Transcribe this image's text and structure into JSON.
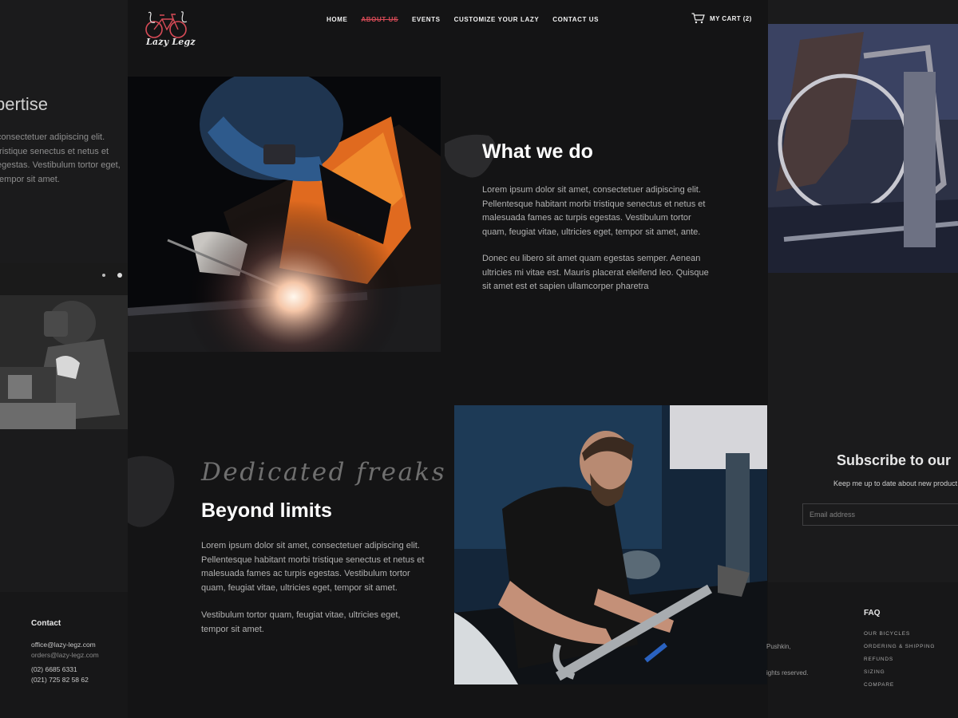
{
  "brand": {
    "name": "Lazy Legz",
    "accent": "#d84b57"
  },
  "nav": {
    "items": [
      {
        "label": "HOME",
        "active": false
      },
      {
        "label": "ABOUT US",
        "active": true
      },
      {
        "label": "EVENTS",
        "active": false
      },
      {
        "label": "CUSTOMIZE YOUR LAZY",
        "active": false
      },
      {
        "label": "CONTACT US",
        "active": false
      }
    ],
    "cart_icon": "cart-icon",
    "cart_label": "MY CART (2)"
  },
  "left_panel": {
    "heading": "pertise",
    "text": "consectetuer adipiscing elit. tristique senectus et netus et egestas. Vestibulum tortor eget, tempor sit amet."
  },
  "what_we_do": {
    "title": "What we do",
    "para1": "Lorem ipsum dolor sit amet, consectetuer adipiscing elit. Pellentesque habitant morbi tristique senectus et netus et malesuada fames ac turpis egestas. Vestibulum tortor quam, feugiat vitae, ultricies eget, tempor sit amet, ante.",
    "para2": "Donec eu libero sit amet quam egestas semper. Aenean ultricies mi vitae est. Mauris placerat eleifend leo. Quisque sit amet est et sapien ullamcorper pharetra"
  },
  "beyond_limits": {
    "script": "Dedicated freaks",
    "title": "Beyond limits",
    "para1": "Lorem ipsum dolor sit amet, consectetuer adipiscing elit. Pellentesque habitant morbi tristique senectus et netus et malesuada fames ac turpis egestas. Vestibulum tortor quam, feugiat vitae, ultricies eget, tempor sit amet.",
    "para2": "Vestibulum tortor quam, feugiat vitae, ultricies eget, tempor sit amet."
  },
  "subscribe": {
    "title": "Subscribe to our",
    "text": "Keep me up to date about new product",
    "placeholder": "Email address"
  },
  "footer": {
    "contact_heading": "Contact",
    "email1": "office@lazy-legz.com",
    "email2": "orders@lazy-legz.com",
    "phone1": "(02) 6685 6331",
    "phone2": "(021) 725 82 58 62",
    "address_fragment": "Pushkin,",
    "rights_fragment": "ights reserved.",
    "faq_heading": "FAQ",
    "faq_links": [
      "OUR BICYCLES",
      "ORDERING & SHIPPING",
      "REFUNDS",
      "SIZING",
      "COMPARE"
    ]
  }
}
